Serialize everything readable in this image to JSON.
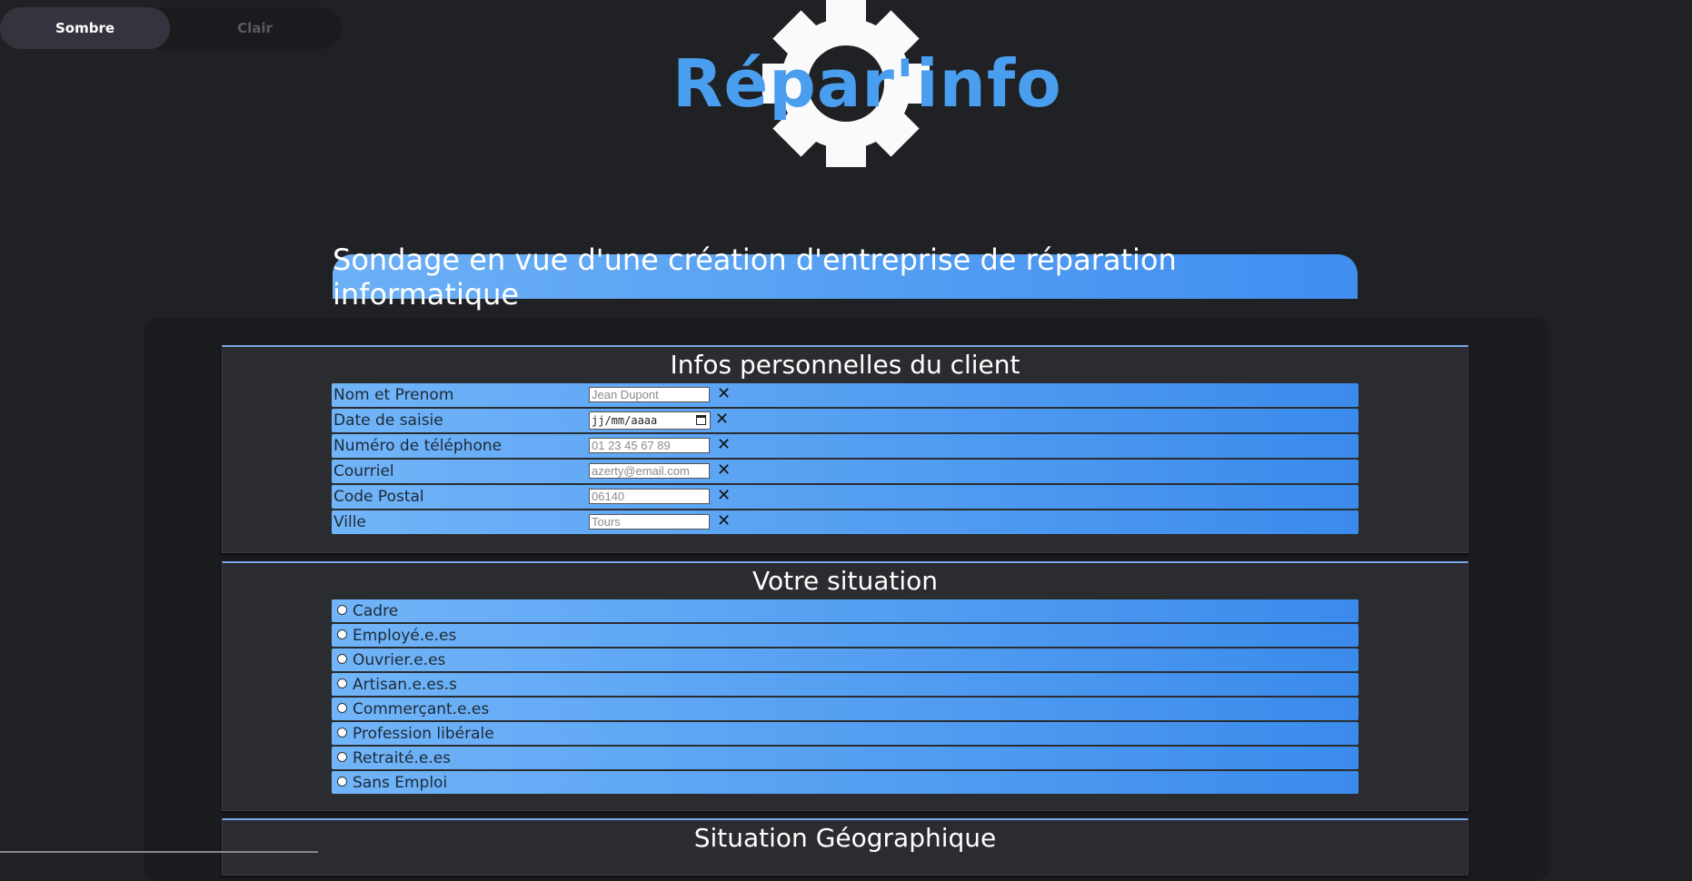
{
  "theme": {
    "dark_label": "Sombre",
    "light_label": "Clair"
  },
  "logo": {
    "text": "Répar'info"
  },
  "banner": {
    "title": "Sondage en vue d'une création d'entreprise de réparation informatique"
  },
  "personal": {
    "heading": "Infos personnelles du client",
    "fields": [
      {
        "label": "Nom et Prenom",
        "placeholder": "Jean Dupont"
      },
      {
        "label": "Date de saisie",
        "placeholder": "jj/mm/aaaa"
      },
      {
        "label": "Numéro de téléphone",
        "placeholder": "01 23 45 67 89"
      },
      {
        "label": "Courriel",
        "placeholder": "azerty@email.com"
      },
      {
        "label": "Code Postal",
        "placeholder": "06140"
      },
      {
        "label": "Ville",
        "placeholder": "Tours"
      }
    ],
    "clear_glyph": "✕"
  },
  "situation": {
    "heading": "Votre situation",
    "options": [
      "Cadre",
      "Employé.e.es",
      "Ouvrier.e.es",
      "Artisan.e.es.s",
      "Commerçant.e.es",
      "Profession libérale",
      "Retraité.e.es",
      "Sans Emploi"
    ]
  },
  "geo": {
    "heading": "Situation Géographique"
  },
  "colors": {
    "accent": "#4a9ef0",
    "background": "#202124",
    "row_start": "#71b4f8",
    "row_end": "#3a8bec"
  }
}
